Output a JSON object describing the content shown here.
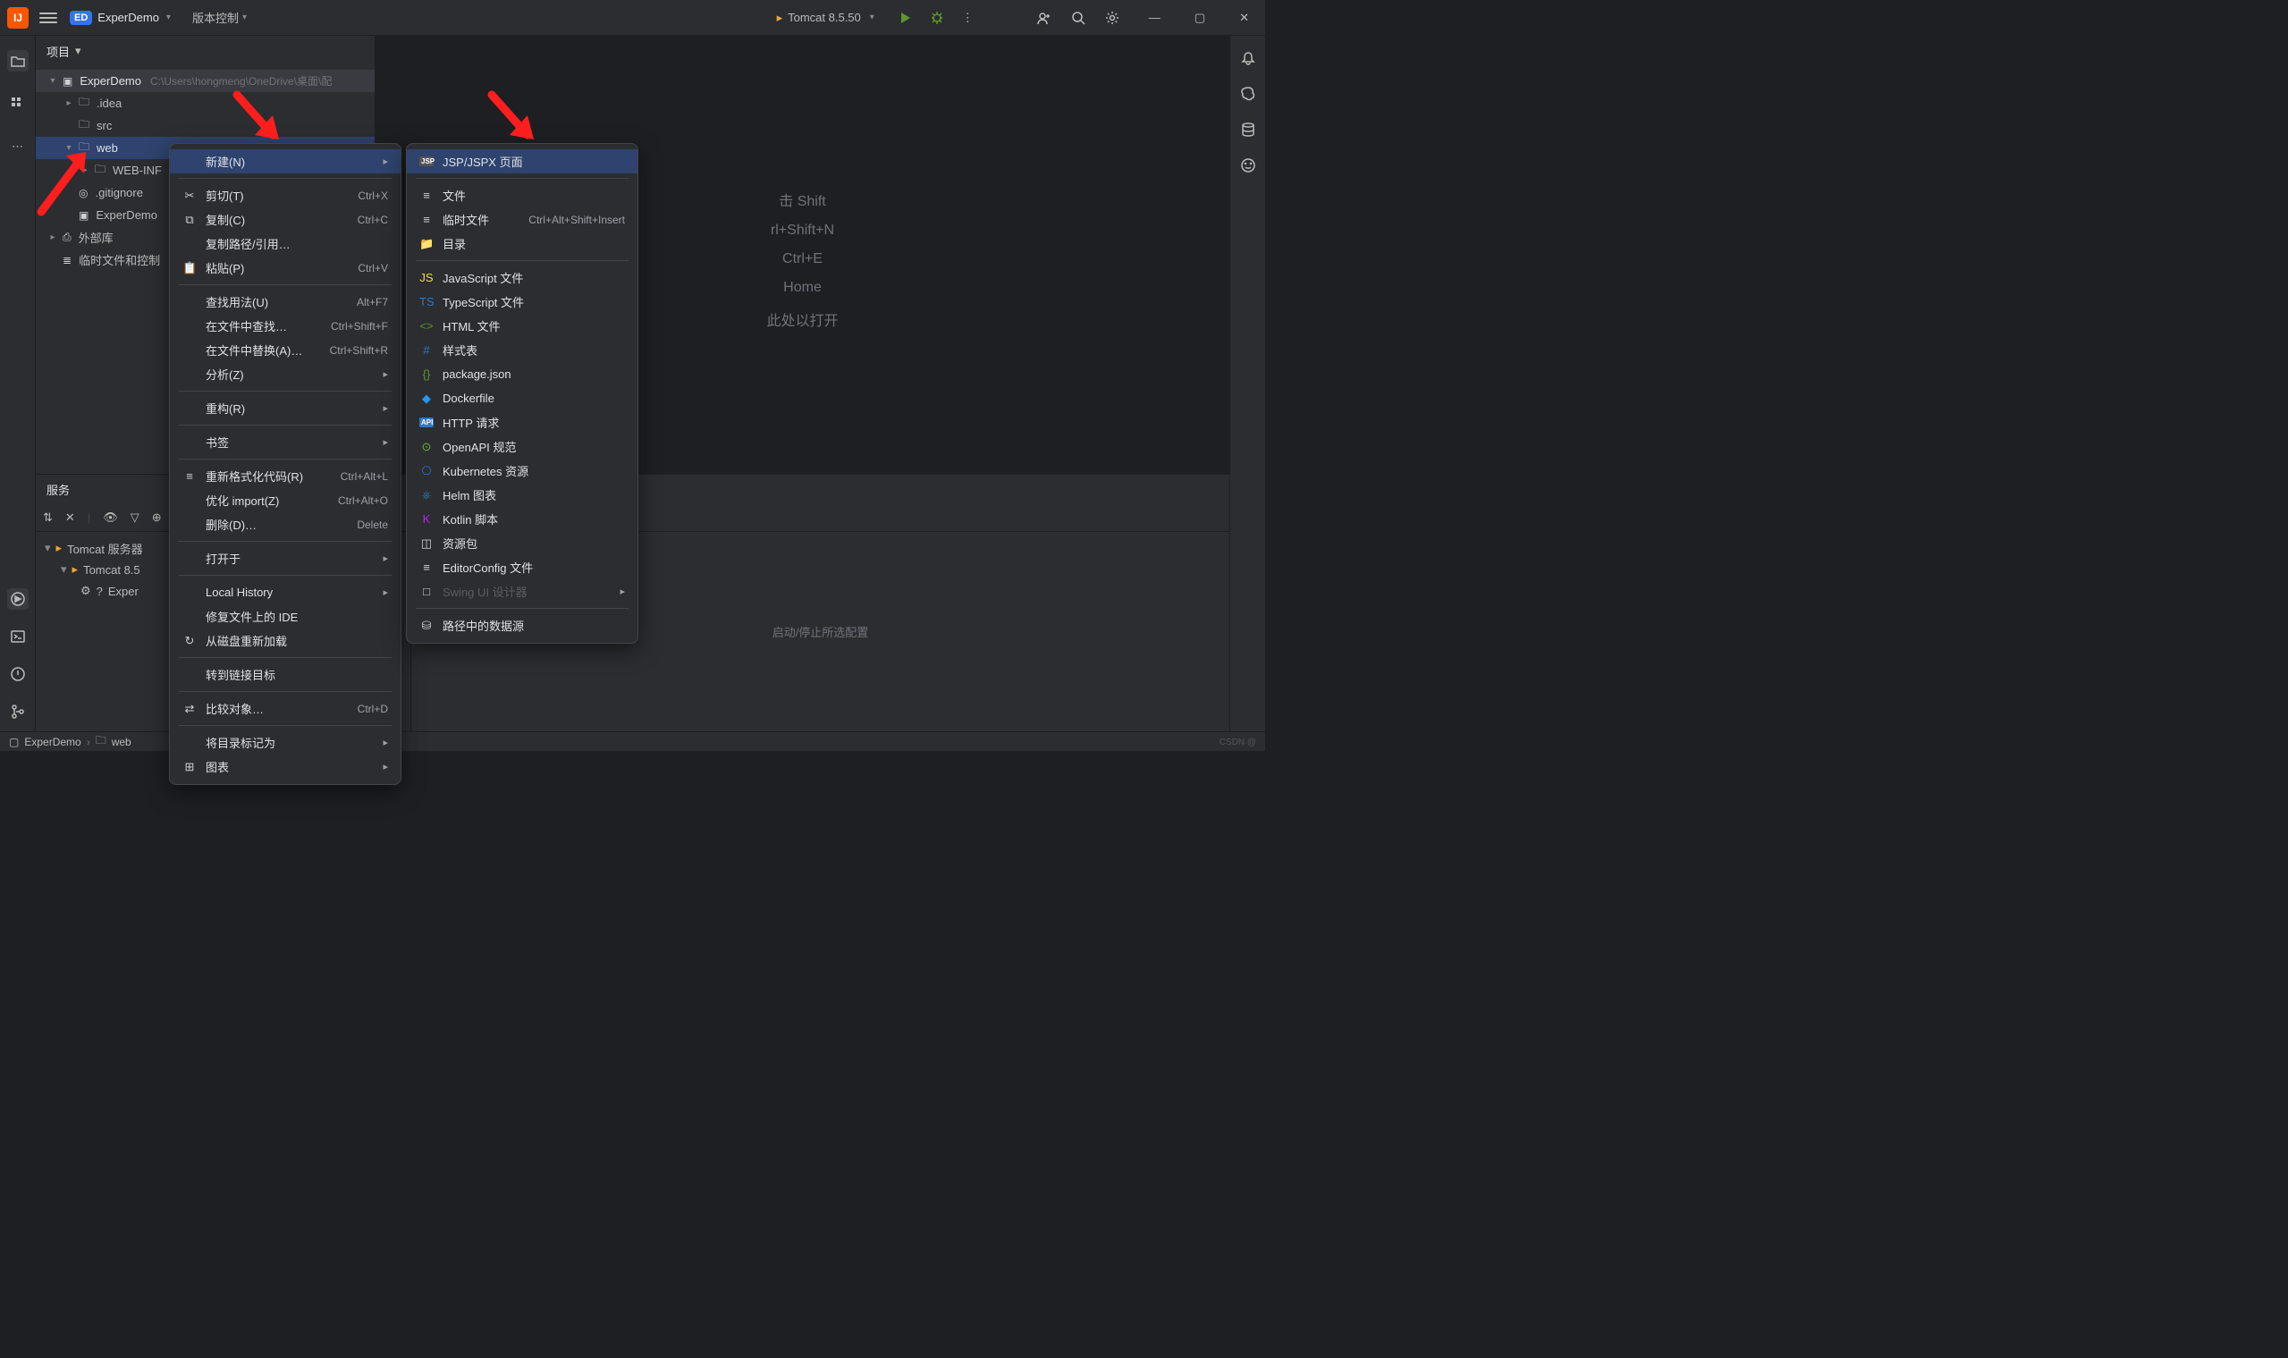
{
  "titlebar": {
    "project_badge": "ED",
    "project_name": "ExperDemo",
    "vcs_menu": "版本控制",
    "run_config": "Tomcat 8.5.50"
  },
  "project_pane": {
    "title": "项目",
    "root": {
      "name": "ExperDemo",
      "path": "C:\\Users\\hongmeng\\OneDrive\\桌面\\配"
    },
    "items": [
      {
        "name": ".idea"
      },
      {
        "name": "src"
      },
      {
        "name": "web"
      },
      {
        "name": "WEB-INF"
      },
      {
        "name": ".gitignore"
      },
      {
        "name": "ExperDemo"
      },
      {
        "name": "外部库"
      },
      {
        "name": "临时文件和控制"
      }
    ]
  },
  "editor_hints": {
    "h1": "击 Shift",
    "h2": "rl+Shift+N",
    "h3": "Ctrl+E",
    "h4": "Home",
    "h5": "此处以打开"
  },
  "services": {
    "title": "服务",
    "tree": {
      "root": "Tomcat 服务器",
      "child": "Tomcat 8.5",
      "leaf": "Exper"
    },
    "center": "启动/停止所选配置"
  },
  "status": {
    "b1": "ExperDemo",
    "b2": "web"
  },
  "context_menu": [
    {
      "icon": "",
      "label": "新建(N)",
      "shortcut": "",
      "sub": true,
      "highlight": true
    },
    {
      "sep": true
    },
    {
      "icon": "✂",
      "label": "剪切(T)",
      "shortcut": "Ctrl+X"
    },
    {
      "icon": "⧉",
      "label": "复制(C)",
      "shortcut": "Ctrl+C"
    },
    {
      "icon": "",
      "label": "复制路径/引用…",
      "shortcut": ""
    },
    {
      "icon": "📋",
      "label": "粘贴(P)",
      "shortcut": "Ctrl+V"
    },
    {
      "sep": true
    },
    {
      "icon": "",
      "label": "查找用法(U)",
      "shortcut": "Alt+F7"
    },
    {
      "icon": "",
      "label": "在文件中查找…",
      "shortcut": "Ctrl+Shift+F"
    },
    {
      "icon": "",
      "label": "在文件中替换(A)…",
      "shortcut": "Ctrl+Shift+R"
    },
    {
      "icon": "",
      "label": "分析(Z)",
      "shortcut": "",
      "sub": true
    },
    {
      "sep": true
    },
    {
      "icon": "",
      "label": "重构(R)",
      "shortcut": "",
      "sub": true
    },
    {
      "sep": true
    },
    {
      "icon": "",
      "label": "书签",
      "shortcut": "",
      "sub": true
    },
    {
      "sep": true
    },
    {
      "icon": "≡",
      "label": "重新格式化代码(R)",
      "shortcut": "Ctrl+Alt+L"
    },
    {
      "icon": "",
      "label": "优化 import(Z)",
      "shortcut": "Ctrl+Alt+O"
    },
    {
      "icon": "",
      "label": "删除(D)…",
      "shortcut": "Delete"
    },
    {
      "sep": true
    },
    {
      "icon": "",
      "label": "打开于",
      "shortcut": "",
      "sub": true
    },
    {
      "sep": true
    },
    {
      "icon": "",
      "label": "Local History",
      "shortcut": "",
      "sub": true
    },
    {
      "icon": "",
      "label": "修复文件上的 IDE",
      "shortcut": ""
    },
    {
      "icon": "↻",
      "label": "从磁盘重新加载",
      "shortcut": ""
    },
    {
      "sep": true
    },
    {
      "icon": "",
      "label": "转到链接目标",
      "shortcut": ""
    },
    {
      "sep": true
    },
    {
      "icon": "⇄",
      "label": "比较对象…",
      "shortcut": "Ctrl+D"
    },
    {
      "sep": true
    },
    {
      "icon": "",
      "label": "将目录标记为",
      "shortcut": "",
      "sub": true
    },
    {
      "icon": "⊞",
      "label": "图表",
      "shortcut": "",
      "sub": true
    }
  ],
  "new_submenu": [
    {
      "icon": "JSP",
      "label": "JSP/JSPX 页面",
      "highlight": true
    },
    {
      "sep": true
    },
    {
      "icon": "≡",
      "label": "文件"
    },
    {
      "icon": "≡",
      "label": "临时文件",
      "shortcut": "Ctrl+Alt+Shift+Insert"
    },
    {
      "icon": "📁",
      "label": "目录"
    },
    {
      "sep": true
    },
    {
      "icon": "JS",
      "label": "JavaScript 文件",
      "color": "#f0db4f"
    },
    {
      "icon": "TS",
      "label": "TypeScript 文件",
      "color": "#3178c6"
    },
    {
      "icon": "<>",
      "label": "HTML 文件",
      "color": "#5c962c"
    },
    {
      "icon": "#",
      "label": "样式表",
      "color": "#3178c6"
    },
    {
      "icon": "{}",
      "label": "package.json",
      "color": "#5c962c"
    },
    {
      "icon": "◆",
      "label": "Dockerfile",
      "color": "#2496ed"
    },
    {
      "icon": "API",
      "label": "HTTP 请求",
      "color": "#3178c6"
    },
    {
      "icon": "⊙",
      "label": "OpenAPI 规范",
      "color": "#6cb33f"
    },
    {
      "icon": "⎔",
      "label": "Kubernetes 资源",
      "color": "#326ce5"
    },
    {
      "icon": "⎈",
      "label": "Helm 图表",
      "color": "#277a9f"
    },
    {
      "icon": "K",
      "label": "Kotlin 脚本",
      "color": "#b125ea"
    },
    {
      "icon": "◫",
      "label": "资源包"
    },
    {
      "icon": "≡",
      "label": "EditorConfig 文件"
    },
    {
      "icon": "□",
      "label": "Swing UI 设计器",
      "disabled": true,
      "sub": true
    },
    {
      "sep": true
    },
    {
      "icon": "⛁",
      "label": "路径中的数据源"
    }
  ],
  "watermark": "CSDN @"
}
